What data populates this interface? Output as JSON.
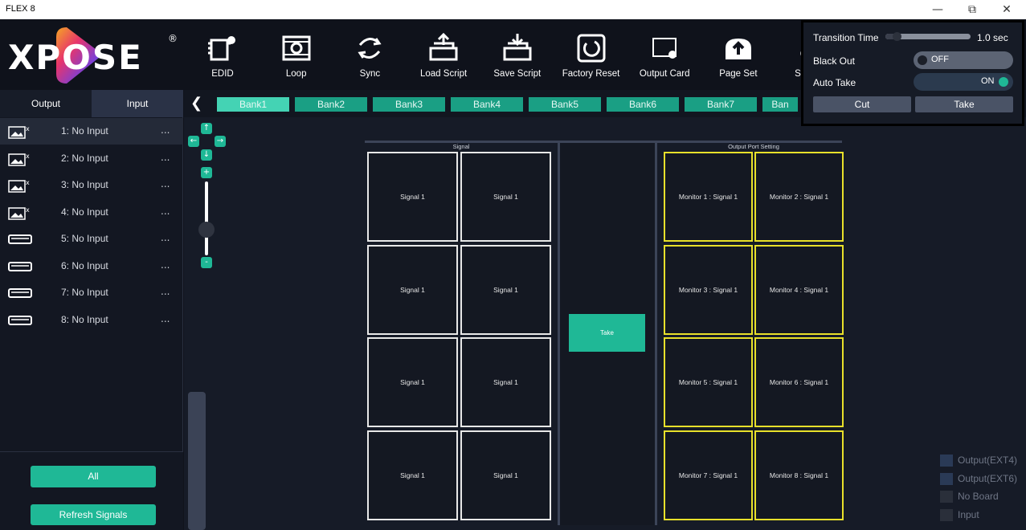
{
  "window": {
    "title": "FLEX 8",
    "minimize": "—",
    "restore": "⧉",
    "close": "✕"
  },
  "logo": {
    "text": "XPOSE",
    "reg": "®"
  },
  "toolbar": [
    {
      "label": "EDID",
      "icon": "edid-icon"
    },
    {
      "label": "Loop",
      "icon": "loop-icon"
    },
    {
      "label": "Sync",
      "icon": "sync-icon"
    },
    {
      "label": "Load Script",
      "icon": "load-script-icon"
    },
    {
      "label": "Save Script",
      "icon": "save-script-icon"
    },
    {
      "label": "Factory Reset",
      "icon": "factory-reset-icon"
    },
    {
      "label": "Output Card",
      "icon": "output-card-icon"
    },
    {
      "label": "Page Set",
      "icon": "page-set-icon"
    },
    {
      "label": "Shortcut",
      "icon": "shortcut-icon"
    }
  ],
  "tabs": {
    "output": "Output",
    "input": "Input"
  },
  "inputs": [
    {
      "name": "1: No Input",
      "dots": "...",
      "icon": "image-input-icon",
      "selected": true
    },
    {
      "name": "2: No Input",
      "dots": "...",
      "icon": "image-input-icon"
    },
    {
      "name": "3: No Input",
      "dots": "...",
      "icon": "image-input-icon"
    },
    {
      "name": "4: No Input",
      "dots": "...",
      "icon": "image-input-icon"
    },
    {
      "name": "5: No Input",
      "dots": "...",
      "icon": "hdmi-port-icon"
    },
    {
      "name": "6: No Input",
      "dots": "...",
      "icon": "hdmi-port-icon"
    },
    {
      "name": "7: No Input",
      "dots": "...",
      "icon": "hdmi-port-icon"
    },
    {
      "name": "8: No Input",
      "dots": "...",
      "icon": "hdmi-port-icon"
    }
  ],
  "left_buttons": {
    "all": "All",
    "refresh": "Refresh Signals"
  },
  "banks": {
    "prev": "❮",
    "items": [
      "Bank1",
      "Bank2",
      "Bank3",
      "Bank4",
      "Bank5",
      "Bank6",
      "Bank7",
      "Ban"
    ],
    "active_index": 0
  },
  "nav": {
    "up": "↑",
    "down": "↓",
    "left": "←",
    "right": "→",
    "zoom_in": "+",
    "zoom_out": "-"
  },
  "signal_panel": {
    "title": "Signal",
    "cells": [
      "Signal 1",
      "Signal 1",
      "Signal 1",
      "Signal 1",
      "Signal 1",
      "Signal 1",
      "Signal 1",
      "Signal 1"
    ]
  },
  "take_center": "Take",
  "output_panel": {
    "title": "Output Port  Setting",
    "cells": [
      "Monitor  1 : Signal 1",
      "Monitor  2 : Signal 1",
      "Monitor  3 : Signal 1",
      "Monitor  4 : Signal 1",
      "Monitor  5 : Signal 1",
      "Monitor  6 : Signal 1",
      "Monitor  7 : Signal 1",
      "Monitor  8 : Signal 1"
    ]
  },
  "popup": {
    "transition_label": "Transition Time",
    "transition_value": "1.0  sec",
    "transition_fraction": 0.05,
    "black_out_label": "Black Out",
    "black_out_state": "OFF",
    "auto_take_label": "Auto Take",
    "auto_take_state": "ON",
    "cut": "Cut",
    "take": "Take"
  },
  "legend": [
    {
      "label": "Output(EXT4)",
      "color": "#2a3a56"
    },
    {
      "label": "Output(EXT6)",
      "color": "#2a3a56"
    },
    {
      "label": "No Board",
      "color": "#2a2f3a"
    },
    {
      "label": "Input",
      "color": "#2a2f3a"
    }
  ],
  "colors": {
    "accent": "#1fb896",
    "monitor_border": "#e8e02a",
    "signal_border": "#e8e8e8"
  }
}
